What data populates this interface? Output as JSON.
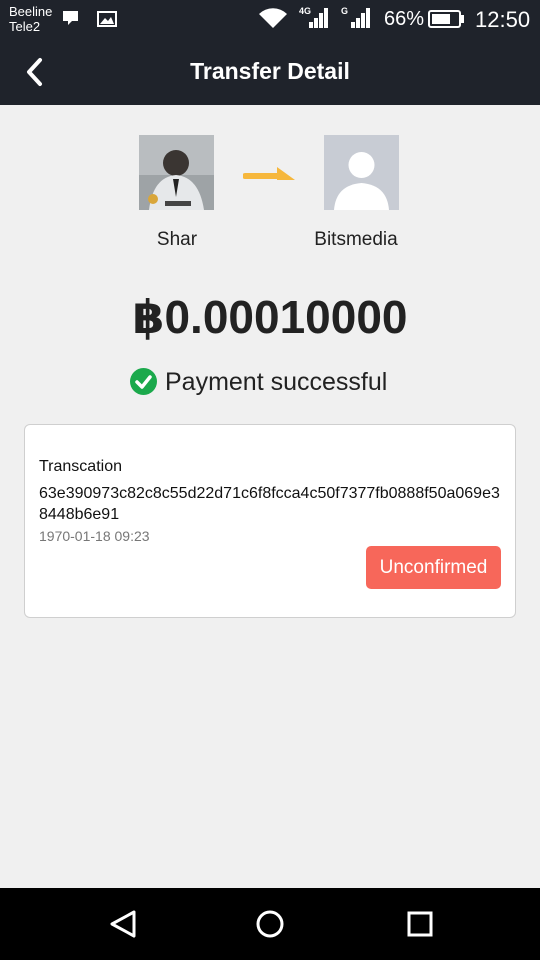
{
  "status_bar": {
    "carrier_1": "Beeline",
    "carrier_2": "Tele2",
    "signal_1_tag": "4G",
    "signal_2_tag": "G",
    "battery": "66%",
    "time": "12:50"
  },
  "header": {
    "title": "Transfer Detail"
  },
  "sender": {
    "name": "Shar"
  },
  "receiver": {
    "name": "Bitsmedia"
  },
  "amount": "฿0.00010000",
  "payment_status": "Payment successful",
  "transaction": {
    "label": "Transcation",
    "hash": "63e390973c82c8c55d22d71c6f8fcca4c50f7377fb0888f50a069e38448b6e91",
    "timestamp": "1970-01-18 09:23",
    "status": "Unconfirmed"
  },
  "colors": {
    "header_bg": "#1f232b",
    "arrow": "#f6b73c",
    "success": "#1ba94c",
    "badge": "#f7675a"
  }
}
